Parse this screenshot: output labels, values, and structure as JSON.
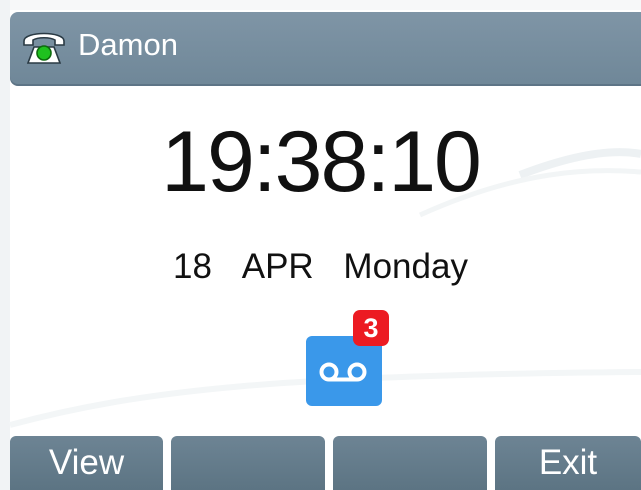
{
  "status_bar": {
    "account_name": "Damon",
    "line_icon": "phone-registered-icon"
  },
  "idle": {
    "time": "19:38:10",
    "date": {
      "day": "18",
      "month": "APR",
      "weekday": "Monday"
    }
  },
  "voicemail": {
    "icon": "voicemail-icon",
    "count": "3",
    "badge_color": "#ec1b22",
    "icon_color": "#3a98ea"
  },
  "softkeys": [
    {
      "label": "View"
    },
    {
      "label": ""
    },
    {
      "label": ""
    },
    {
      "label": "Exit"
    }
  ]
}
